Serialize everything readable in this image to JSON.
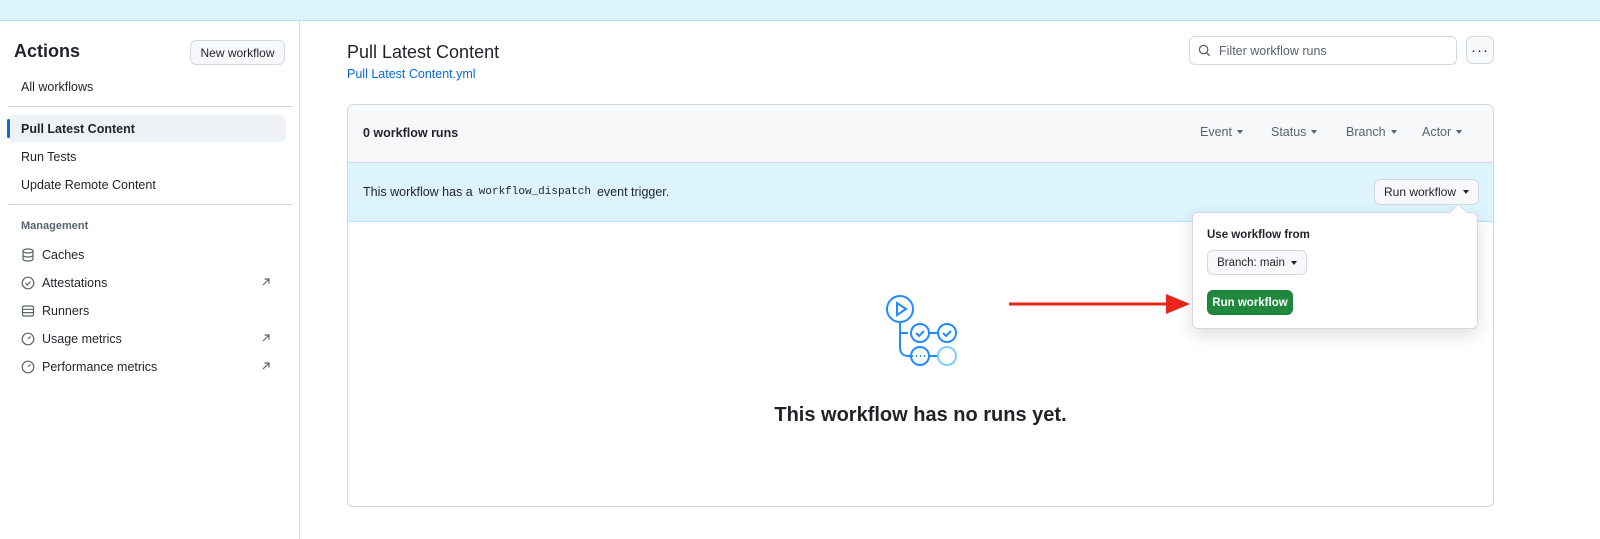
{
  "sidebar": {
    "title": "Actions",
    "new_workflow_label": "New workflow",
    "all_workflows": "All workflows",
    "workflows": [
      "Pull Latest Content",
      "Run Tests",
      "Update Remote Content"
    ],
    "management_title": "Management",
    "management_items": [
      {
        "label": "Caches",
        "icon": "database-icon",
        "external": false
      },
      {
        "label": "Attestations",
        "icon": "check-circle-icon",
        "external": true
      },
      {
        "label": "Runners",
        "icon": "server-icon",
        "external": false
      },
      {
        "label": "Usage metrics",
        "icon": "meter-icon",
        "external": true
      },
      {
        "label": "Performance metrics",
        "icon": "meter-icon",
        "external": true
      }
    ]
  },
  "main": {
    "title": "Pull Latest Content",
    "file_link": "Pull Latest Content.yml",
    "filter_placeholder": "Filter workflow runs",
    "more_label": "···",
    "runs_count": "0 workflow runs",
    "filters": [
      "Event",
      "Status",
      "Branch",
      "Actor"
    ],
    "dispatch_prefix": "This workflow has a",
    "dispatch_code": "workflow_dispatch",
    "dispatch_suffix": "event trigger.",
    "run_workflow_dropdown": "Run workflow",
    "empty_message": "This workflow has no runs yet."
  },
  "popup": {
    "label": "Use workflow from",
    "branch_button": "Branch: main",
    "run_button": "Run workflow"
  },
  "colors": {
    "accent": "#0969da",
    "primary_button": "#1f883d",
    "annotation_arrow": "#e8271c",
    "info_background": "#ddf4ff"
  }
}
